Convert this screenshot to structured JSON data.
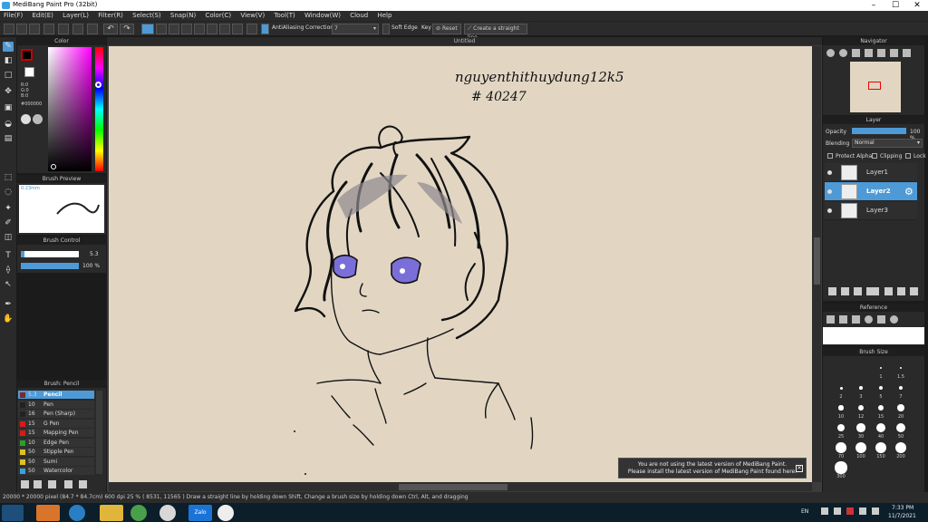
{
  "window": {
    "title": "MediBang Paint Pro (32bit)"
  },
  "menu": [
    "File(F)",
    "Edit(E)",
    "Layer(L)",
    "Filter(R)",
    "Select(S)",
    "Snap(N)",
    "Color(C)",
    "View(V)",
    "Tool(T)",
    "Window(W)",
    "Cloud",
    "Help"
  ],
  "toolbar": {
    "antialiasing": "AntiAliasing",
    "correction_label": "Correction",
    "correction_value": "7",
    "soft_edge": "Soft Edge",
    "key": "Key",
    "reset": "Reset",
    "straight_line": "Create a straight line"
  },
  "document_tab": "Untitled",
  "color_panel": {
    "title": "Color",
    "r": "R:0",
    "g": "G:0",
    "b": "B:0",
    "hex": "#000000",
    "primary": "#000000"
  },
  "brush_preview": {
    "title": "Brush Preview",
    "size": "0.23mm"
  },
  "brush_control": {
    "title": "Brush Control",
    "size_value": "5.3",
    "opacity_value": "100 %"
  },
  "brush_panel": {
    "title": "Brush: Pencil",
    "items": [
      {
        "size": "5.3",
        "name": "Pencil",
        "color": "#7a2a2a"
      },
      {
        "size": "10",
        "name": "Pen",
        "color": "#222222"
      },
      {
        "size": "16",
        "name": "Pen (Sharp)",
        "color": "#222222"
      },
      {
        "size": "15",
        "name": "G Pen",
        "color": "#d81a1a"
      },
      {
        "size": "15",
        "name": "Mapping Pen",
        "color": "#d81a1a"
      },
      {
        "size": "10",
        "name": "Edge Pen",
        "color": "#2aa02a"
      },
      {
        "size": "50",
        "name": "Stipple Pen",
        "color": "#e0c020"
      },
      {
        "size": "50",
        "name": "Sumi",
        "color": "#e0c020"
      },
      {
        "size": "50",
        "name": "Watercolor",
        "color": "#3aa0e0"
      }
    ]
  },
  "navigator": {
    "title": "Navigator"
  },
  "layer_panel": {
    "title": "Layer",
    "opacity_label": "Opacity",
    "opacity_value": "100 %",
    "opacity_fraction": 1.0,
    "blending_label": "Blending",
    "blending_value": "Normal",
    "protect_alpha": "Protect Alpha",
    "clipping": "Clipping",
    "lock": "Lock",
    "layers": [
      {
        "name": "Layer1",
        "selected": false
      },
      {
        "name": "Layer2",
        "selected": true
      },
      {
        "name": "Layer3",
        "selected": false
      }
    ]
  },
  "reference_panel": {
    "title": "Reference"
  },
  "brush_size_panel": {
    "title": "Brush Size",
    "labels": [
      "1",
      "1.5",
      "2",
      "3",
      "5",
      "7",
      "10",
      "12",
      "15",
      "20",
      "25",
      "30",
      "40",
      "50",
      "70",
      "100",
      "150",
      "200",
      "300"
    ]
  },
  "canvas_text": {
    "line1": "nguyenthithuydung12k5",
    "line2": "# 40247"
  },
  "notice": {
    "line1": "You are not using the latest version of MediBang Paint.",
    "line2": "Please install the latest version of MediBang Paint found here."
  },
  "status": {
    "dimensions": "20000 * 20000 pixel",
    "physical": "(84.7 * 84.7cm)",
    "dpi": "600 dpi",
    "zoom": "25 %",
    "coords": "( 8531, 11565 )",
    "hint": "Draw a straight line by holding down Shift, Change a brush size by holding down Ctrl, Alt, and dragging"
  },
  "taskbar": {
    "lang": "EN",
    "time": "7:33 PM",
    "date": "11/7/2021",
    "zalo": "Zalo"
  },
  "colors": {
    "accent": "#4e9ad6",
    "panel": "#2a2a2a",
    "canvas": "#e2d6c3"
  }
}
